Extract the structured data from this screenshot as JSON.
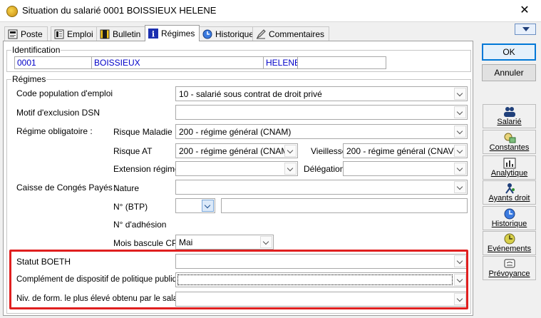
{
  "window": {
    "title": "Situation du salarié 0001 BOISSIEUX HELENE",
    "close": "✕"
  },
  "tabs": [
    {
      "label": "Poste",
      "active": false
    },
    {
      "label": "Emploi",
      "active": false
    },
    {
      "label": "Bulletin",
      "active": false
    },
    {
      "label": "Régimes",
      "active": true
    },
    {
      "label": "Historique",
      "active": false
    },
    {
      "label": "Commentaires",
      "active": false
    }
  ],
  "identification": {
    "title": "Identification",
    "code": "0001",
    "nom": "BOISSIEUX",
    "prenom": "HELENE"
  },
  "regimes": {
    "title": "Régimes",
    "code_population_label": "Code population d'emploi",
    "code_population_value": "10 - salarié sous contrat de droit privé",
    "motif_exclusion_label": "Motif d'exclusion DSN",
    "motif_exclusion_value": "",
    "regime_obligatoire_label": "Régime obligatoire :",
    "risque_maladie_label": "Risque Maladie",
    "risque_maladie_value": "200 - régime général (CNAM)",
    "risque_at_label": "Risque AT",
    "risque_at_value": "200 - régime général (CNAM)",
    "vieillesse_label": "Vieillesse",
    "vieillesse_value": "200 - régime général (CNAV)",
    "extension_label": "Extension régime",
    "extension_value": "",
    "delegation_label": "Délégation",
    "delegation_value": "",
    "caisse_cp_label": "Caisse de Congés Payés :",
    "nature_label": "Nature",
    "nature_value": "",
    "num_btp_label": "N° (BTP)",
    "num_btp_value": "",
    "num_adhesion_label": "N° d'adhésion",
    "mois_bascule_label": "Mois bascule CP",
    "mois_bascule_value": "Mai",
    "statut_boeth_label": "Statut BOETH",
    "statut_boeth_value": "",
    "complement_label": "Complément de dispositif de politique publique",
    "complement_value": "",
    "niv_form_label": "Niv. de form. le plus élevé obtenu par le salarié",
    "niv_form_value": ""
  },
  "buttons": {
    "ok": "OK",
    "annuler": "Annuler"
  },
  "side_buttons": [
    {
      "label": "Salarié",
      "icon": "people-icon"
    },
    {
      "label": "Constantes",
      "icon": "constants-icon"
    },
    {
      "label": "Analytique",
      "icon": "chart-icon"
    },
    {
      "label": "Ayants droit",
      "icon": "person-link-icon"
    },
    {
      "label": "Historique",
      "icon": "clock-icon"
    },
    {
      "label": "Evénements",
      "icon": "events-clock-icon"
    },
    {
      "label": "Prévoyance",
      "icon": "contract-icon"
    }
  ],
  "colors": {
    "highlight": "#e01f1f",
    "id_text": "#0000c8",
    "default_button": "#0078d7"
  }
}
